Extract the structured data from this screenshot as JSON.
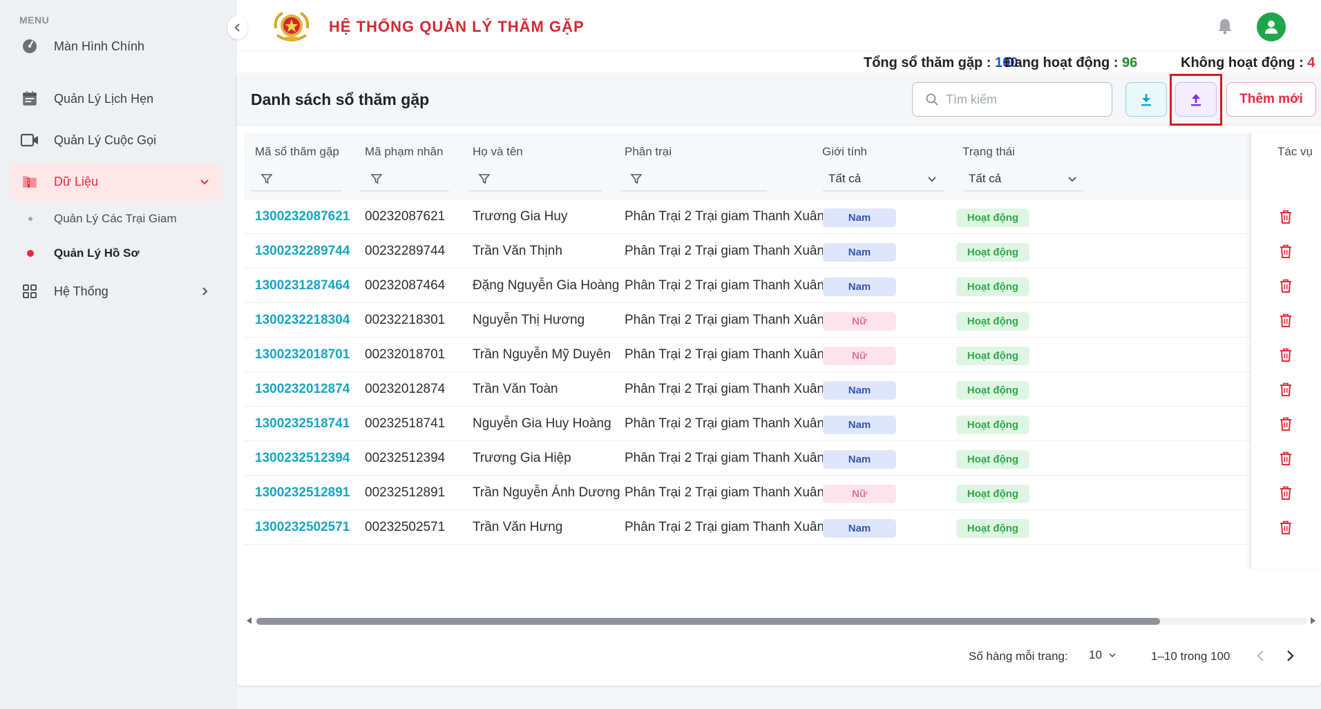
{
  "sidebar": {
    "menu_label": "MENU",
    "items": [
      {
        "label": "Màn Hình Chính"
      },
      {
        "label": "Quản Lý Lịch Hẹn"
      },
      {
        "label": "Quản Lý Cuộc Gọi"
      },
      {
        "label": "Dữ Liệu"
      },
      {
        "label": "Quản Lý Các Trại Giam"
      },
      {
        "label": "Quản Lý Hồ Sơ"
      },
      {
        "label": "Hệ Thống"
      }
    ]
  },
  "header": {
    "title": "HỆ THỐNG QUẢN LÝ THĂM GẶP"
  },
  "stats": {
    "total_label": "Tổng sổ thăm gặp :",
    "total_value": "100",
    "active_label": "Đang hoạt động :",
    "active_value": "96",
    "inactive_label": "Không hoạt động :",
    "inactive_value": "4"
  },
  "card": {
    "title": "Danh sách sổ thăm gặp",
    "search_placeholder": "Tìm kiếm",
    "add_label": "Thêm mới"
  },
  "table": {
    "columns": [
      "Mã sổ thăm gặp",
      "Mã phạm nhân",
      "Họ và tên",
      "Phân trại",
      "Giới tính",
      "Trạng thái",
      "Tác vụ"
    ],
    "gender_filter": "Tất cả",
    "status_filter": "Tất cả",
    "rows": [
      {
        "code": "1300232087621",
        "prisoner": "00232087621",
        "name": "Trương Gia Huy",
        "camp": "Phân Trại 2 Trại giam Thanh Xuân",
        "gender": "Nam",
        "status": "Hoạt động"
      },
      {
        "code": "1300232289744",
        "prisoner": "00232289744",
        "name": "Trần Văn Thịnh",
        "camp": "Phân Trại 2 Trại giam Thanh Xuân",
        "gender": "Nam",
        "status": "Hoạt động"
      },
      {
        "code": "1300231287464",
        "prisoner": "00232087464",
        "name": "Đặng Nguyễn Gia Hoàng",
        "camp": "Phân Trại 2 Trại giam Thanh Xuân",
        "gender": "Nam",
        "status": "Hoạt động"
      },
      {
        "code": "1300232218304",
        "prisoner": "00232218301",
        "name": "Nguyễn Thị Hương",
        "camp": "Phân Trại 2 Trại giam Thanh Xuân",
        "gender": "Nữ",
        "status": "Hoạt động"
      },
      {
        "code": "1300232018701",
        "prisoner": "00232018701",
        "name": "Trần Nguyễn Mỹ Duyên",
        "camp": "Phân Trại 2 Trại giam Thanh Xuân",
        "gender": "Nữ",
        "status": "Hoạt động"
      },
      {
        "code": "1300232012874",
        "prisoner": "00232012874",
        "name": "Trần Văn Toàn",
        "camp": "Phân Trại 2 Trại giam Thanh Xuân",
        "gender": "Nam",
        "status": "Hoạt động"
      },
      {
        "code": "1300232518741",
        "prisoner": "00232518741",
        "name": "Nguyễn Gia Huy Hoàng",
        "camp": "Phân Trại 2 Trại giam Thanh Xuân",
        "gender": "Nam",
        "status": "Hoạt động"
      },
      {
        "code": "1300232512394",
        "prisoner": "00232512394",
        "name": "Trương Gia Hiệp",
        "camp": "Phân Trại 2 Trại giam Thanh Xuân",
        "gender": "Nam",
        "status": "Hoạt động"
      },
      {
        "code": "1300232512891",
        "prisoner": "00232512891",
        "name": "Trần Nguyễn Ánh Dương",
        "camp": "Phân Trại 2 Trại giam Thanh Xuân",
        "gender": "Nữ",
        "status": "Hoạt động"
      },
      {
        "code": "1300232502571",
        "prisoner": "00232502571",
        "name": "Trần Văn Hưng",
        "camp": "Phân Trại 2 Trại giam Thanh Xuân",
        "gender": "Nam",
        "status": "Hoạt động"
      }
    ]
  },
  "pagination": {
    "rows_per_page_label": "Số hàng mỗi trang:",
    "rows_per_page": "10",
    "range": "1–10 trong 100"
  },
  "colors": {
    "accent_red": "#e52b3a",
    "link_cyan": "#16a5c4",
    "active_green": "#2fa847",
    "highlight_box": "#d71920"
  },
  "icons": [
    "dashboard-icon",
    "calendar-icon",
    "video-camera-icon",
    "folder-icon",
    "grid-icon",
    "bell-icon",
    "user-avatar-icon",
    "search-icon",
    "download-icon",
    "upload-icon",
    "filter-icon",
    "trash-icon",
    "chevron-down-icon",
    "chevron-left-icon",
    "chevron-right-icon"
  ]
}
